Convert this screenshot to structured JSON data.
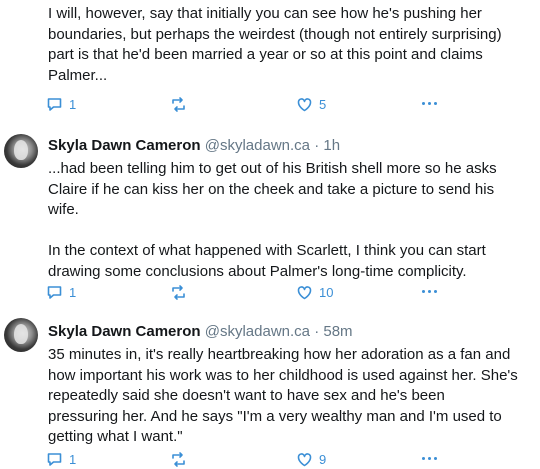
{
  "tweets": [
    {
      "text": "I will, however, say that initially you can see how he's pushing her boundaries, but perhaps the weirdest (though not entirely surprising) part is that he'd been married a year or so at this point and claims Palmer...",
      "replies": "1",
      "likes": "5"
    },
    {
      "name": "Skyla Dawn Cameron",
      "handle": "@skyladawn.ca",
      "separator": "·",
      "time": "1h",
      "text": "...had been telling him to get out of his British shell more so he asks Claire if he can kiss her on the cheek and take a picture to send his wife.\n\nIn the context of what happened with Scarlett, I think you can start drawing some conclusions about Palmer's long-time complicity.",
      "replies": "1",
      "likes": "10"
    },
    {
      "name": "Skyla Dawn Cameron",
      "handle": "@skyladawn.ca",
      "separator": "·",
      "time": "58m",
      "text": "35 minutes in, it's really heartbreaking how her adoration as a fan and how important his work was to her childhood is used against her. She's repeatedly said she doesn't want to have sex and he's been pressuring her. And he says \"I'm a very wealthy man and I'm used to getting what I want.\"",
      "replies": "1",
      "likes": "9"
    }
  ],
  "icons": {
    "reply": "reply-icon",
    "repost": "repost-icon",
    "like": "heart-icon",
    "more": "more-icon"
  },
  "colors": {
    "accent": "#3b8fd6",
    "text": "#14171a",
    "muted": "#657786"
  }
}
